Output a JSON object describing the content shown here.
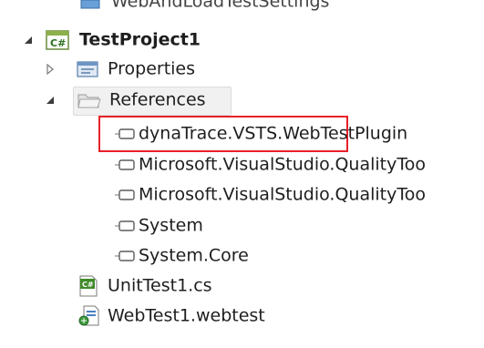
{
  "tree": {
    "top_partial_label": "WebAndLoadTestSettings",
    "project": {
      "label": "TestProject1",
      "icon": "csharp-project-icon"
    },
    "properties": {
      "label": "Properties",
      "icon": "properties-icon"
    },
    "references": {
      "label": "References",
      "icon": "folder-icon",
      "items": [
        {
          "label": "dynaTrace.VSTS.WebTestPlugin",
          "icon": "reference-icon"
        },
        {
          "label": "Microsoft.VisualStudio.QualityToo",
          "icon": "reference-icon"
        },
        {
          "label": "Microsoft.VisualStudio.QualityToo",
          "icon": "reference-icon"
        },
        {
          "label": "System",
          "icon": "reference-icon"
        },
        {
          "label": "System.Core",
          "icon": "reference-icon"
        }
      ]
    },
    "files": [
      {
        "label": "UnitTest1.cs",
        "icon": "csharp-file-icon"
      },
      {
        "label": "WebTest1.webtest",
        "icon": "webtest-file-icon"
      }
    ]
  },
  "colors": {
    "highlight_border": "#e8202a",
    "text": "#1e1e1e"
  }
}
